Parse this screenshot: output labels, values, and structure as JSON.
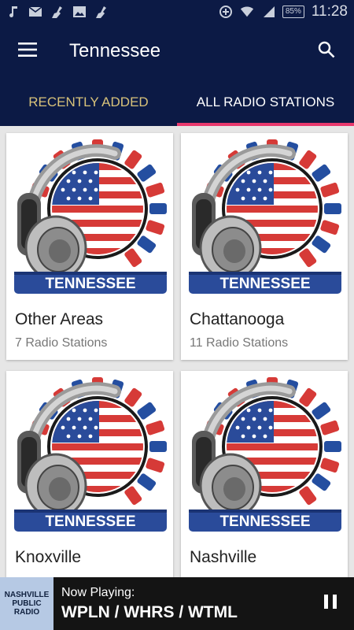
{
  "status_bar": {
    "time": "11:28",
    "battery": "85%",
    "icons": [
      "music-icon",
      "mail-icon",
      "cleaner-icon",
      "image-icon",
      "cleaner-icon",
      "data-saver-icon",
      "wifi-icon",
      "signal-icon",
      "battery-icon"
    ]
  },
  "app_bar": {
    "title": "Tennessee",
    "menu_icon": "hamburger-menu-icon",
    "search_icon": "search-icon"
  },
  "tabs": [
    {
      "label": "RECENTLY ADDED",
      "selected": false
    },
    {
      "label": "ALL RADIO STATIONS",
      "selected": true
    }
  ],
  "cards": [
    {
      "title": "Other Areas",
      "subtitle": "7 Radio Stations",
      "badge": "TENNESSEE"
    },
    {
      "title": "Chattanooga",
      "subtitle": "11 Radio Stations",
      "badge": "TENNESSEE"
    },
    {
      "title": "Knoxville",
      "subtitle": "",
      "badge": "TENNESSEE"
    },
    {
      "title": "Nashville",
      "subtitle": "",
      "badge": "TENNESSEE"
    }
  ],
  "player": {
    "label": "Now Playing:",
    "station": "WPLN / WHRS / WTML",
    "logo_line1": "NASHVILLE",
    "logo_line2": "PUBLIC RADIO",
    "control_icon": "pause-icon"
  },
  "colors": {
    "primary": "#0c1a45",
    "tab_indicator": "#e8396d",
    "inactive_tab": "#d8c27a",
    "player_bg": "#141414"
  }
}
